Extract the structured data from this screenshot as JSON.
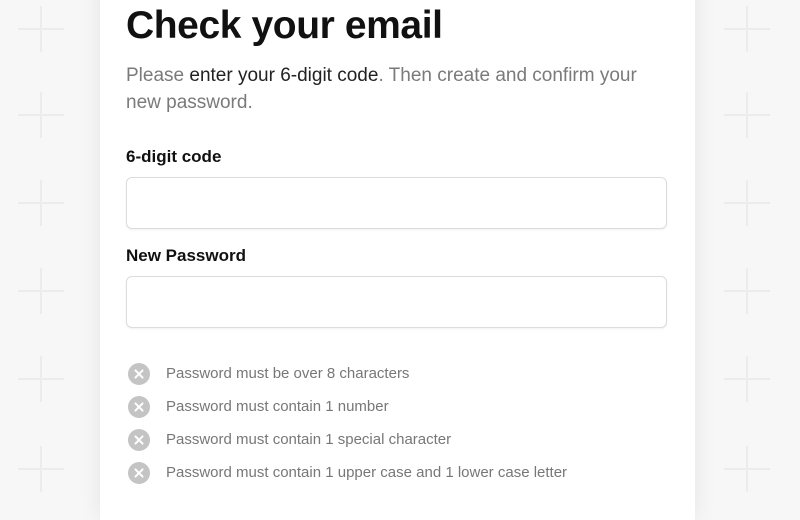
{
  "header": {
    "title": "Check your email"
  },
  "intro": {
    "prefix": "Please ",
    "emphasis": "enter your 6-digit code",
    "suffix": ". Then create and confirm your new password."
  },
  "form": {
    "code_label": "6-digit code",
    "code_value": "",
    "password_label": "New Password",
    "password_value": ""
  },
  "requirements": [
    {
      "text": "Password must be over 8 characters",
      "status": "unmet",
      "icon": "x-circle-icon"
    },
    {
      "text": "Password must contain 1 number",
      "status": "unmet",
      "icon": "x-circle-icon"
    },
    {
      "text": "Password must contain 1 special character",
      "status": "unmet",
      "icon": "x-circle-icon"
    },
    {
      "text": "Password must contain 1 upper case and 1 lower case letter",
      "status": "unmet",
      "icon": "x-circle-icon"
    }
  ],
  "colors": {
    "background": "#f7f7f7",
    "card": "#ffffff",
    "text": "#111111",
    "muted_text": "#7a7a7a",
    "requirement_icon": "#c4c4c4",
    "input_border": "#dcdcdc"
  }
}
